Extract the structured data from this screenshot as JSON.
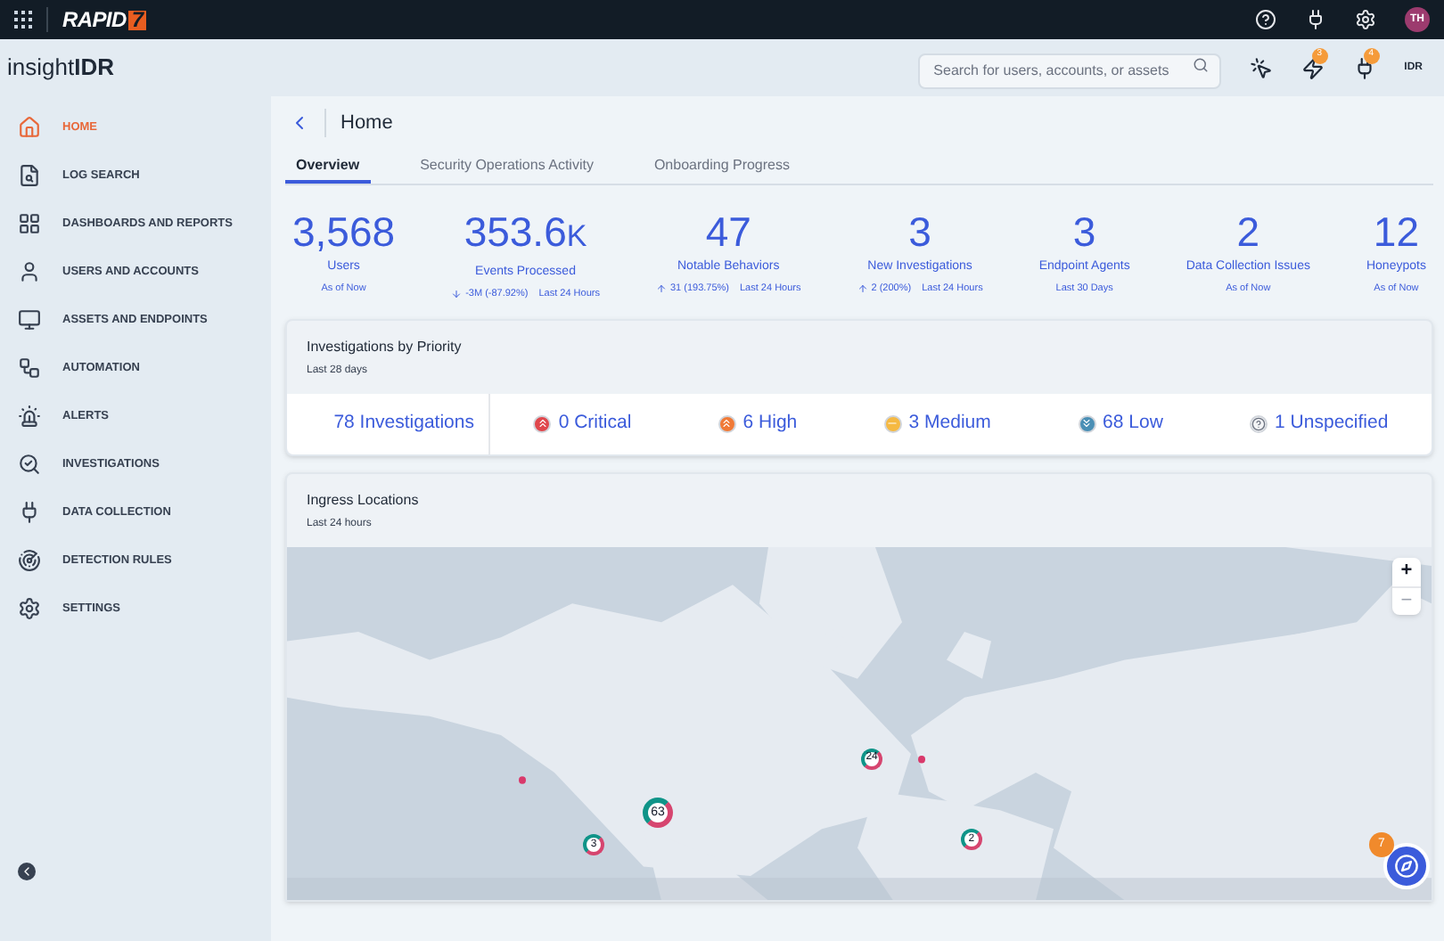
{
  "topbar": {
    "logo": "RAPID",
    "logo_mark": "7",
    "avatar": "TH"
  },
  "header": {
    "product_light": "insight",
    "product_bold": "IDR",
    "search": {
      "placeholder": "Search for users, accounts, or assets"
    },
    "icon_badges": [
      "3",
      "4"
    ],
    "app_mark": "IDR"
  },
  "sidebar": {
    "items": [
      {
        "label": "HOME",
        "selected": true
      },
      {
        "label": "LOG SEARCH",
        "selected": false
      },
      {
        "label": "DASHBOARDS AND REPORTS",
        "selected": false
      },
      {
        "label": "USERS AND ACCOUNTS",
        "selected": false
      },
      {
        "label": "ASSETS AND ENDPOINTS",
        "selected": false
      },
      {
        "label": "AUTOMATION",
        "selected": false
      },
      {
        "label": "ALERTS",
        "selected": false
      },
      {
        "label": "INVESTIGATIONS",
        "selected": false
      },
      {
        "label": "DATA COLLECTION",
        "selected": false
      },
      {
        "label": "DETECTION RULES",
        "selected": false
      },
      {
        "label": "SETTINGS",
        "selected": false
      }
    ]
  },
  "page": {
    "title": "Home",
    "tabs": [
      {
        "label": "Overview",
        "selected": true
      },
      {
        "label": "Security Operations Activity",
        "selected": false
      },
      {
        "label": "Onboarding Progress",
        "selected": false
      }
    ]
  },
  "stats": [
    {
      "value": "3,568",
      "label": "Users",
      "note": "As of Now"
    },
    {
      "value": "353.6",
      "suffix": "K",
      "label": "Events Processed",
      "kind": "decrease",
      "change": "-3M (-87.92%)",
      "note": "Last 24 Hours"
    },
    {
      "value": "47",
      "label": "Notable Behaviors",
      "kind": "increase",
      "change": "31 (193.75%)",
      "note": "Last 24 Hours"
    },
    {
      "value": "3",
      "label": "New Investigations",
      "kind": "increase",
      "change": "2 (200%)",
      "note": "Last 24 Hours"
    },
    {
      "value": "3",
      "label": "Endpoint Agents",
      "note": "Last 30 Days"
    },
    {
      "value": "2",
      "label": "Data Collection Issues",
      "note": "As of Now"
    },
    {
      "value": "12",
      "label": "Honeypots",
      "note": "As of Now"
    }
  ],
  "priority": {
    "title": "Investigations by Priority",
    "subtitle": "Last 28 days",
    "total": "78 Investigations",
    "levels": [
      {
        "kind": "critical",
        "label": "0 Critical",
        "color": "#e0474c"
      },
      {
        "kind": "high",
        "label": "6 High",
        "color": "#f07a37"
      },
      {
        "kind": "medium",
        "label": "3 Medium",
        "color": "#f5b942"
      },
      {
        "kind": "low",
        "label": "68 Low",
        "color": "#4a8fb5"
      },
      {
        "kind": "unspecified",
        "label": "1 Unspecified",
        "color": "#f3f4f6"
      }
    ]
  },
  "ingress": {
    "title": "Ingress Locations",
    "subtitle": "Last 24 hours",
    "clusters": [
      "63",
      "24",
      "3",
      "2"
    ],
    "zoom_in": "+",
    "zoom_out": "−"
  },
  "help": {
    "badge": "7"
  }
}
